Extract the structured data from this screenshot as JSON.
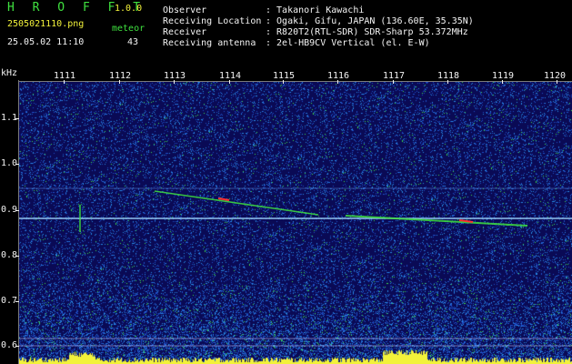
{
  "app": {
    "logo": "H R O F F T",
    "version": "1.0.0",
    "filename": "2505021110.png",
    "datetime": "25.05.02 11:10",
    "meteor_label": "meteor",
    "meteor_count": "43"
  },
  "station": {
    "rows": [
      {
        "label": "Observer",
        "value": ": Takanori Kawachi"
      },
      {
        "label": "Receiving Location",
        "value": ": Ogaki, Gifu, JAPAN (136.60E, 35.35N)"
      },
      {
        "label": "Receiver",
        "value": ": R820T2(RTL-SDR) SDR-Sharp 53.372MHz"
      },
      {
        "label": "Receiving antenna",
        "value": ": 2el-HB9CV Vertical (el. E-W)"
      }
    ]
  },
  "spectrogram": {
    "y_unit": "kHz",
    "y_ticks": [
      "1.1",
      "1.0",
      "0.9",
      "0.8",
      "0.7",
      "0.6"
    ],
    "x_ticks": [
      "1111",
      "1112",
      "1113",
      "1114",
      "1115",
      "1116",
      "1117",
      "1118",
      "1119",
      "1120"
    ],
    "colors": {
      "background": "#0a0a55",
      "signal": "#3fe03f",
      "strong": "#ff3030",
      "activity": "#f2f23a"
    }
  }
}
